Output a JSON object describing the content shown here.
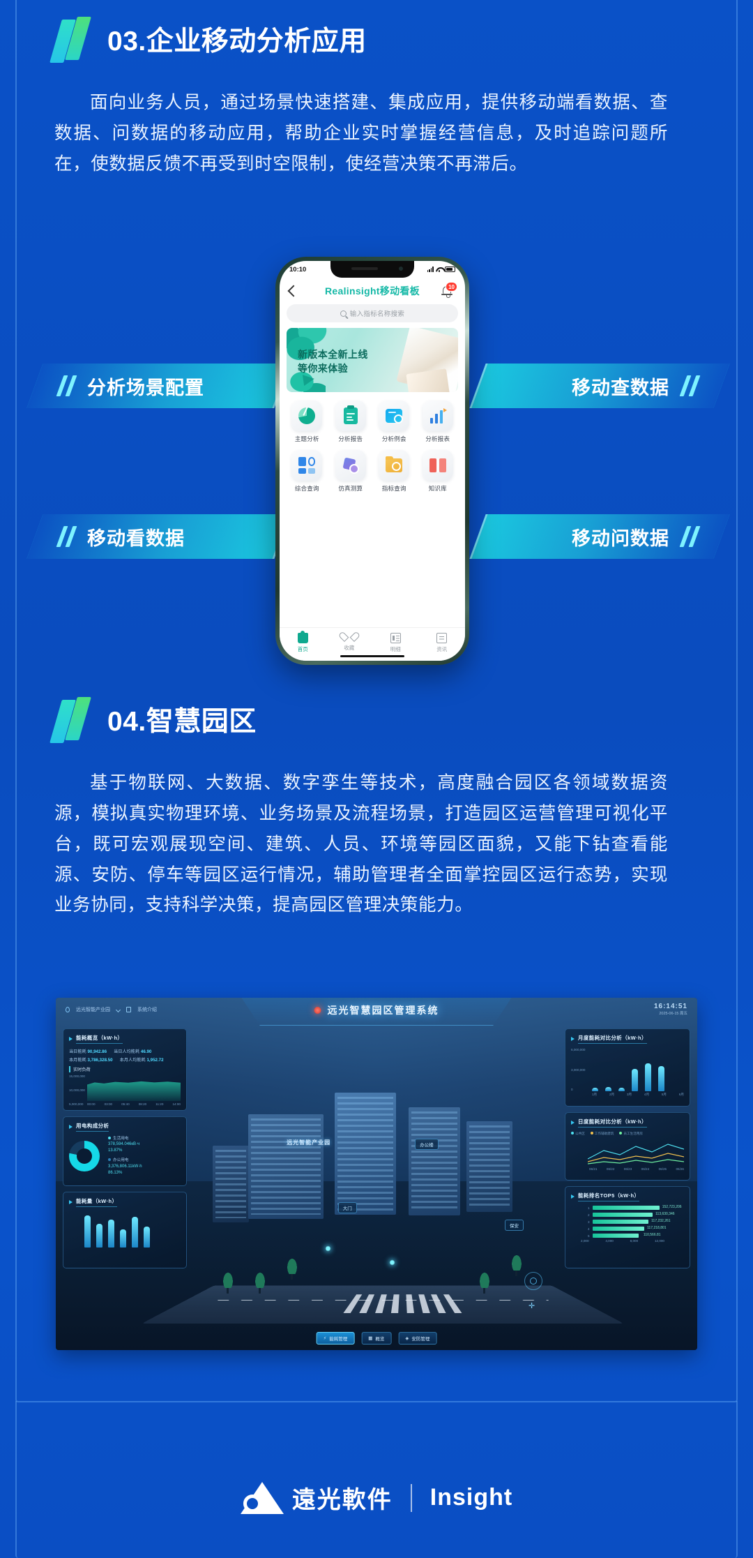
{
  "theme": {
    "bg": "#0a4fc4",
    "accent_cyan": "#3fe0f0",
    "accent_green": "#4ee07c",
    "text": "#ffffff"
  },
  "section03": {
    "number_title": "03.企业移动分析应用",
    "paragraph": "面向业务人员，通过场景快速搭建、集成应用，提供移动端看数据、查数据、问数据的移动应用，帮助企业实时掌握经营信息，及时追踪问题所在，使数据反馈不再受到时空限制，使经营决策不再滞后。",
    "ribbons": [
      {
        "label": "分析场景配置",
        "side": "left"
      },
      {
        "label": "移动查数据",
        "side": "right"
      },
      {
        "label": "移动看数据",
        "side": "left"
      },
      {
        "label": "移动问数据",
        "side": "right"
      }
    ],
    "phone": {
      "status": {
        "time": "10:10",
        "signal_icon": "signal-icon",
        "wifi_icon": "wifi-icon",
        "battery_icon": "battery-icon"
      },
      "app_bar": {
        "back_icon": "back-chevron-icon",
        "title": "Realinsight移动看板",
        "bell_icon": "bell-icon",
        "badge": "10"
      },
      "search": {
        "icon": "search-icon",
        "placeholder": "输入指标名称搜索"
      },
      "banner": {
        "line1": "新版本全新上线",
        "line2": "等你来体验"
      },
      "grid": [
        {
          "label": "主题分析",
          "icon": "pie-chart-icon"
        },
        {
          "label": "分析报告",
          "icon": "clipboard-icon"
        },
        {
          "label": "分析例会",
          "icon": "card-search-icon"
        },
        {
          "label": "分析报表",
          "icon": "bar-chart-icon"
        },
        {
          "label": "综合查询",
          "icon": "squares-search-icon"
        },
        {
          "label": "仿真测算",
          "icon": "cube-icon"
        },
        {
          "label": "指标查询",
          "icon": "folder-search-icon"
        },
        {
          "label": "知识库",
          "icon": "book-icon"
        }
      ],
      "tabs": [
        {
          "label": "首页",
          "icon": "home-icon",
          "active": true
        },
        {
          "label": "收藏",
          "icon": "heart-icon",
          "active": false
        },
        {
          "label": "明细",
          "icon": "list-icon",
          "active": false
        },
        {
          "label": "资讯",
          "icon": "document-icon",
          "active": false
        }
      ]
    }
  },
  "section04": {
    "number_title": "04.智慧园区",
    "paragraph": "基于物联网、大数据、数字孪生等技术，高度融合园区各领域数据资源，模拟真实物理环境、业务场景及流程场景，打造园区运营管理可视化平台，既可宏观展现空间、建筑、人员、环境等园区面貌，又能下钻查看能源、安防、停车等园区运行情况，辅助管理者全面掌控园区运行态势，实现业务协同，支持科学决策，提高园区管理决策能力。",
    "dashboard": {
      "header": {
        "location": "远光智能产业园",
        "dropdown_icon": "chevron-down-icon",
        "location_icon": "pin-icon",
        "intro_icon": "doc-icon",
        "intro_label": "系统介绍",
        "title": "远光智慧园区管理系统",
        "time": "16:14:51",
        "date": "2025-06-15 周五"
      },
      "scene": {
        "park_name": "远光智能产业园",
        "tags": [
          "办公楼",
          "大门",
          "保安"
        ]
      },
      "panels": [
        {
          "id": "energy-overview",
          "title": "能耗概览（kW·h）",
          "metrics": [
            {
              "label": "当日能耗",
              "value": "90,942.86"
            },
            {
              "label": "当日人均能耗",
              "value": "46.90"
            },
            {
              "label": "本月能耗",
              "value": "3,786,328.50"
            },
            {
              "label": "本月人均能耗",
              "value": "1,952.72"
            }
          ],
          "sub_title": "实时负荷",
          "y_ticks": [
            "15,000,000",
            "10,000,000",
            "5,000,000",
            "0"
          ],
          "x_ticks": [
            "00:00",
            "03:00",
            "05:40",
            "08:20",
            "11:20",
            "14:00"
          ]
        },
        {
          "id": "power-composition",
          "title": "用电构成分析",
          "legend": [
            {
              "label": "生活用电",
              "value": "378,594.046кВ·ч",
              "percent": "13.87%"
            },
            {
              "label": "办公用电",
              "value": "3,376,806.11kW·h",
              "percent": "86.13%"
            }
          ]
        },
        {
          "id": "energy-consumption",
          "title": "能耗量（kW·h）"
        },
        {
          "id": "monthly-compare",
          "title": "月度能耗对比分析（kW·h）",
          "y_ticks": [
            "6,000,000",
            "3,000,000",
            "0"
          ],
          "categories": [
            "1月",
            "2月",
            "3月",
            "4月",
            "5月",
            "6月"
          ],
          "values": [
            320000,
            360000,
            330000,
            3100000,
            3700000,
            3400000
          ]
        },
        {
          "id": "daily-compare",
          "title": "日度能耗对比分析（kW·h）",
          "legend": [
            "公共区",
            "工作辅助建筑",
            "员工生活用房"
          ],
          "x_ticks": [
            "06/21",
            "06/22",
            "06/23",
            "06/24",
            "06/25",
            "06/26"
          ]
        },
        {
          "id": "top5",
          "title": "能耗排名TOP5（kW·h）",
          "rows": [
            {
              "rank": "1",
              "value": "152,723,206"
            },
            {
              "rank": "2",
              "value": "113,630,346"
            },
            {
              "rank": "3",
              "value": "117,232,261"
            },
            {
              "rank": "4",
              "value": "117,218,801"
            },
            {
              "rank": "5",
              "value": "110,566.81"
            }
          ],
          "x_ticks": [
            "2,000",
            "4,000",
            "8,000",
            "12,000"
          ]
        }
      ],
      "bottom_nav": [
        {
          "label": "能耗管理",
          "icon": "bolt-icon",
          "active": true
        },
        {
          "label": "概览",
          "icon": "grid-icon",
          "active": false
        },
        {
          "label": "安防管理",
          "icon": "shield-icon",
          "active": false
        }
      ]
    }
  },
  "footer": {
    "brand_cn": "遠光軟件",
    "brand_logo_icon": "yuanguang-triangle-logo",
    "divider": "|",
    "brand_en": "Insight"
  }
}
